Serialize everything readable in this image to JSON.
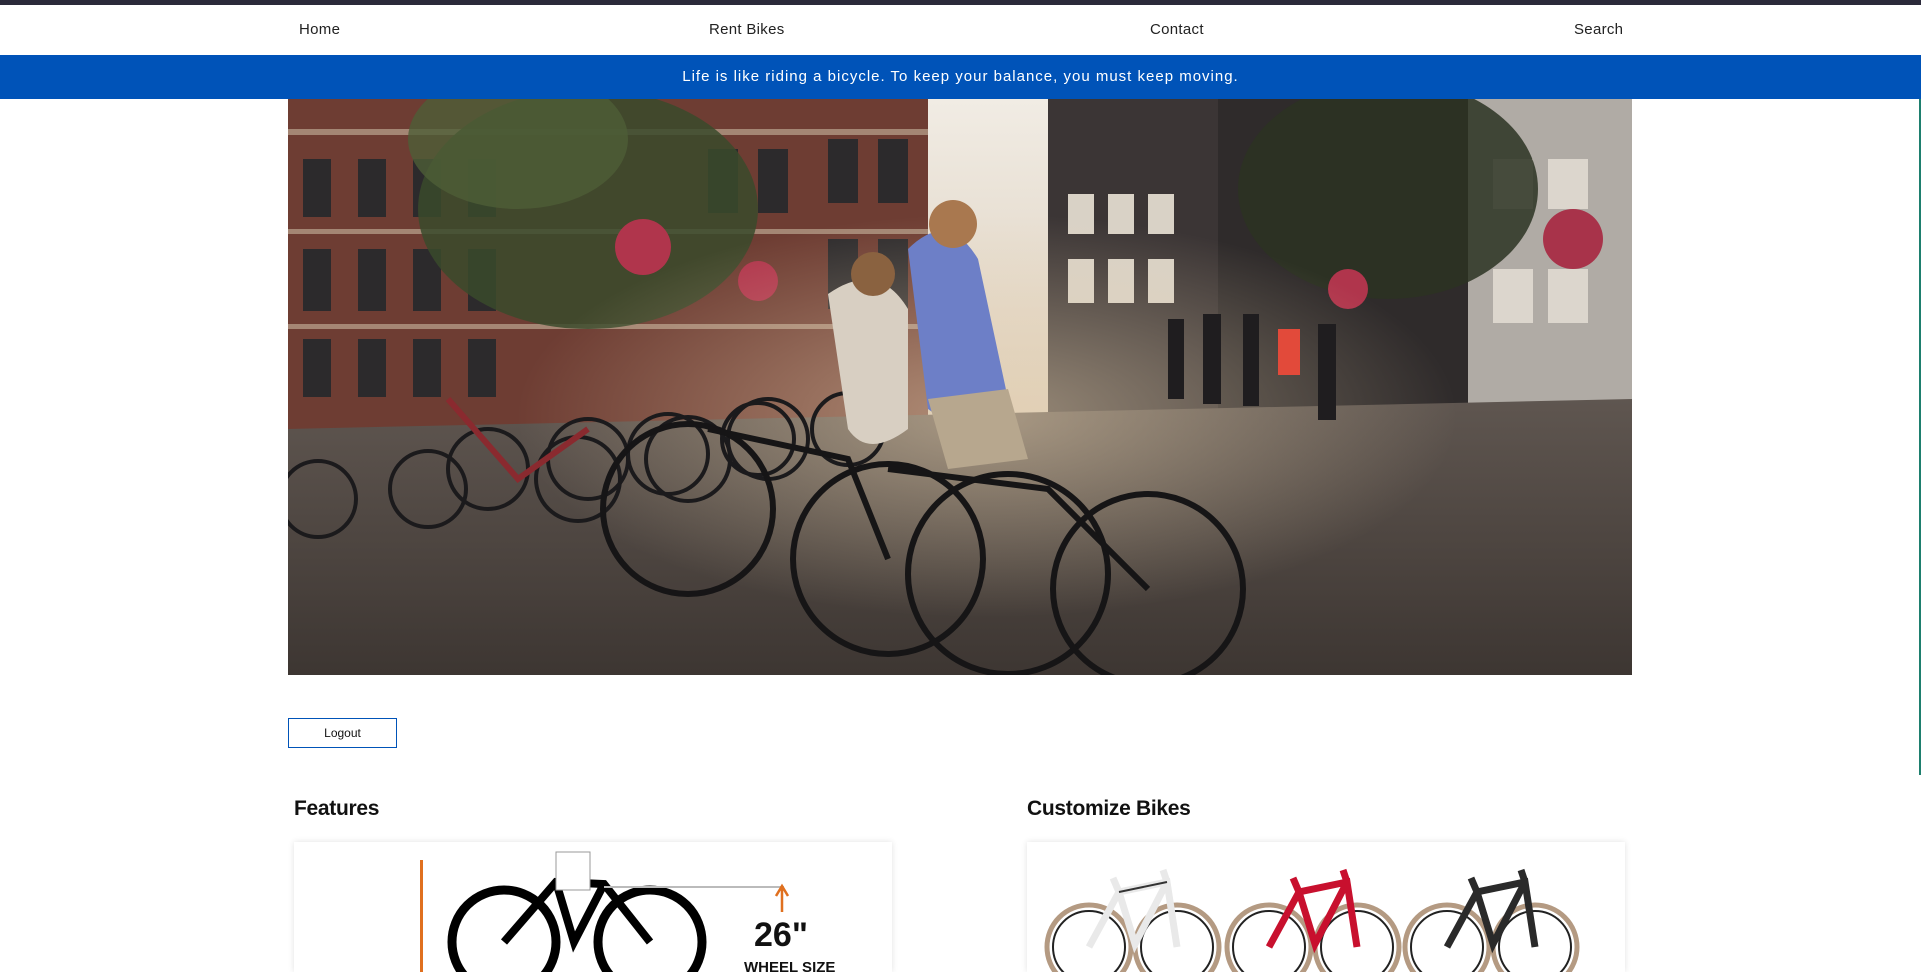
{
  "nav": {
    "home": "Home",
    "rent_bikes": "Rent Bikes",
    "contact": "Contact",
    "search": "Search"
  },
  "banner": {
    "quote": "Life is like riding a bicycle. To keep your balance, you must keep moving."
  },
  "hero": {
    "image": "two cyclists riding on a cobblestone street in Amsterdam with parked bikes and buildings"
  },
  "auth": {
    "logout_label": "Logout"
  },
  "features": {
    "title": "Features",
    "wheel_size": "26\"",
    "wheel_caption": "WHEEL SIZE"
  },
  "customize": {
    "title": "Customize Bikes"
  },
  "colors": {
    "top_strip": "#2b2a3a",
    "banner_bg": "#0053b8",
    "banner_text": "#ffffff",
    "button_border": "#0053b8",
    "bike_red": "#c8102e"
  }
}
